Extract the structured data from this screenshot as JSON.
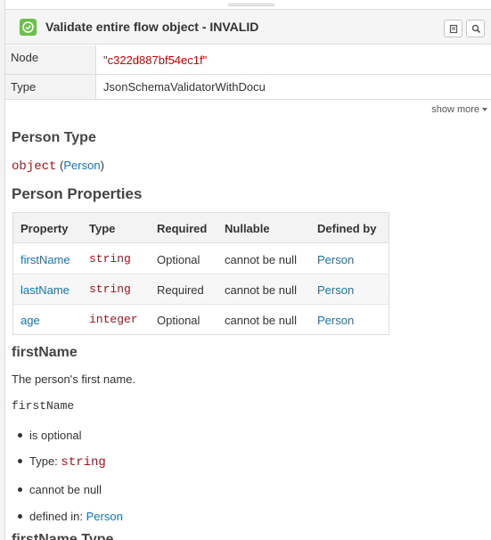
{
  "header": {
    "title": "Validate entire flow object - INVALID",
    "status": "valid-check-icon",
    "accent": "#6cc04a"
  },
  "properties": [
    {
      "key": "Node",
      "value": "\"c322d887bf54ec1f\""
    },
    {
      "key": "Type",
      "value": "JsonSchemaValidatorWithDocu"
    }
  ],
  "show_more": "show more",
  "doc": {
    "type_heading": "Person Type",
    "type_code": "object",
    "type_link": "Person",
    "paren_open": " (",
    "paren_close": ")",
    "props_heading": "Person Properties",
    "table": {
      "headers": [
        "Property",
        "Type",
        "Required",
        "Nullable",
        "Defined by"
      ],
      "rows": [
        {
          "property": "firstName",
          "type": "string",
          "required": "Optional",
          "nullable": "cannot be null",
          "defined_by": "Person"
        },
        {
          "property": "lastName",
          "type": "string",
          "required": "Required",
          "nullable": "cannot be null",
          "defined_by": "Person"
        },
        {
          "property": "age",
          "type": "integer",
          "required": "Optional",
          "nullable": "cannot be null",
          "defined_by": "Person"
        }
      ]
    },
    "field_heading": "firstName",
    "field_desc": "The person's first name.",
    "field_code": "firstName",
    "bullets": {
      "optional": "is optional",
      "type_label": "Type: ",
      "type_value": "string",
      "nullable": "cannot be null",
      "defined_label": "defined in: ",
      "defined_value": "Person"
    },
    "next_heading": "firstName Type"
  }
}
